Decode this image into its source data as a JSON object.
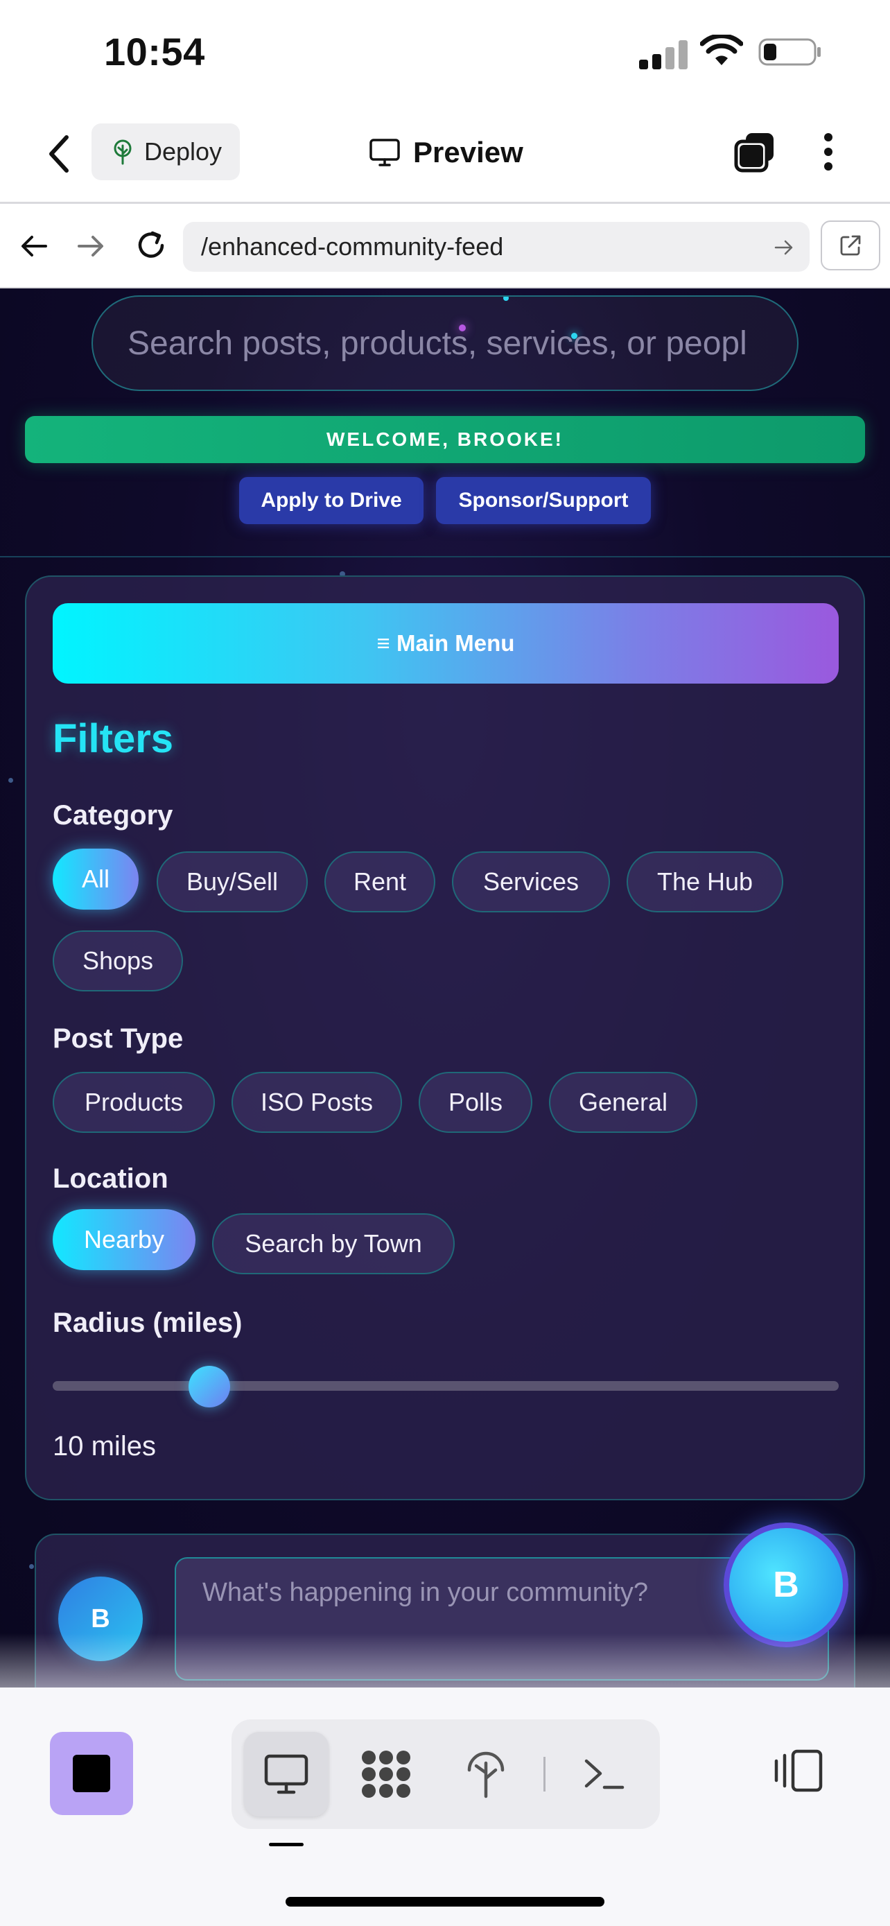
{
  "status_bar": {
    "time": "10:54"
  },
  "app_bar": {
    "deploy_label": "Deploy",
    "title": "Preview"
  },
  "browser": {
    "url": "/enhanced-community-feed"
  },
  "header": {
    "search_placeholder": "Search posts, products, services, or peopl",
    "welcome": "WELCOME, BROOKE!",
    "apply_label": "Apply to Drive",
    "sponsor_label": "Sponsor/Support"
  },
  "filters": {
    "menu_label": "≡ Main Menu",
    "title": "Filters",
    "category_label": "Category",
    "categories": [
      "All",
      "Buy/Sell",
      "Rent",
      "Services",
      "The Hub",
      "Shops"
    ],
    "category_selected": "All",
    "post_type_label": "Post Type",
    "post_types": [
      "Products",
      "ISO Posts",
      "Polls",
      "General"
    ],
    "location_label": "Location",
    "locations": [
      "Nearby",
      "Search by Town"
    ],
    "location_selected": "Nearby",
    "radius_label": "Radius (miles)",
    "radius_value": "10 miles",
    "radius_fraction": 0.2
  },
  "composer": {
    "avatar_initial": "B",
    "placeholder": "What's happening in your community?"
  },
  "fab": {
    "initial": "B"
  },
  "colors": {
    "accent_cyan": "#25e4f5",
    "welcome_green": "#14b37b",
    "button_blue": "#2a3aa8",
    "stop_purple": "#b9a3f5"
  },
  "icons": {
    "deploy": "tree-icon",
    "preview": "monitor-icon",
    "tabs": "tabs-icon",
    "more": "kebab-icon",
    "reload": "reload-icon",
    "open_external": "open-external-icon"
  }
}
